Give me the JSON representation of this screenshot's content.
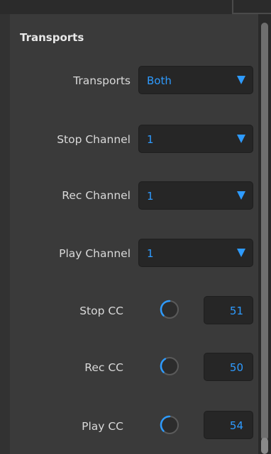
{
  "section": {
    "title": "Transports"
  },
  "rows": [
    {
      "label": "Transports",
      "value": "Both"
    },
    {
      "label": "Stop Channel",
      "value": "1"
    },
    {
      "label": "Rec Channel",
      "value": "1"
    },
    {
      "label": "Play Channel",
      "value": "1"
    }
  ],
  "knobs": [
    {
      "label": "Stop CC",
      "value": "51"
    },
    {
      "label": "Rec CC",
      "value": "50"
    },
    {
      "label": "Play CC",
      "value": "54"
    }
  ],
  "colors": {
    "accent": "#2e9bff",
    "panel": "#3a3a3a",
    "field": "#262626"
  },
  "icons": {
    "dropdown": "triangle-down-icon",
    "knob": "rotary-knob-icon"
  }
}
